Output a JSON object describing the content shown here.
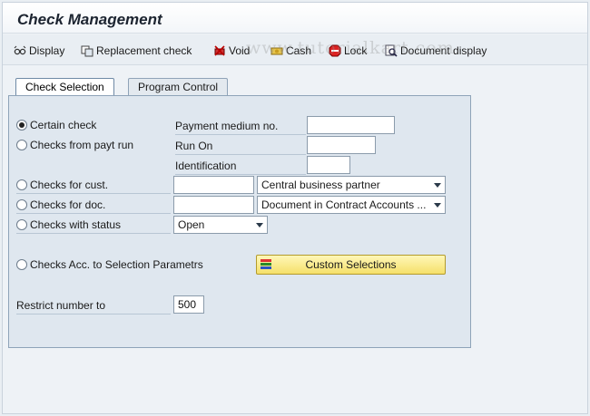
{
  "window": {
    "title": "Check Management"
  },
  "toolbar": {
    "display": "Display",
    "replacement_check": "Replacement check",
    "void": "Void",
    "cash": "Cash",
    "lock": "Lock",
    "document_display": "Document display"
  },
  "watermark": "www.tutorialkart.com",
  "tabs": {
    "check_selection": "Check Selection",
    "program_control": "Program Control"
  },
  "form": {
    "certain_check": "Certain check",
    "payment_medium_no": "Payment medium no.",
    "payment_medium_no_value": "",
    "checks_from_payt_run": "Checks from payt run",
    "run_on": "Run On",
    "run_on_value": "",
    "identification": "Identification",
    "identification_value": "",
    "checks_for_cust": "Checks for cust.",
    "cust_value": "",
    "cust_select": "Central business partner",
    "checks_for_doc": "Checks for doc.",
    "doc_value": "",
    "doc_select": "Document in Contract Accounts ...",
    "checks_with_status": "Checks with status",
    "status_select": "Open",
    "checks_acc_selection": "Checks Acc. to Selection Parametrs",
    "custom_selections": "Custom Selections",
    "restrict_number_to": "Restrict number to",
    "restrict_value": "500",
    "selected_option": "Certain check"
  }
}
